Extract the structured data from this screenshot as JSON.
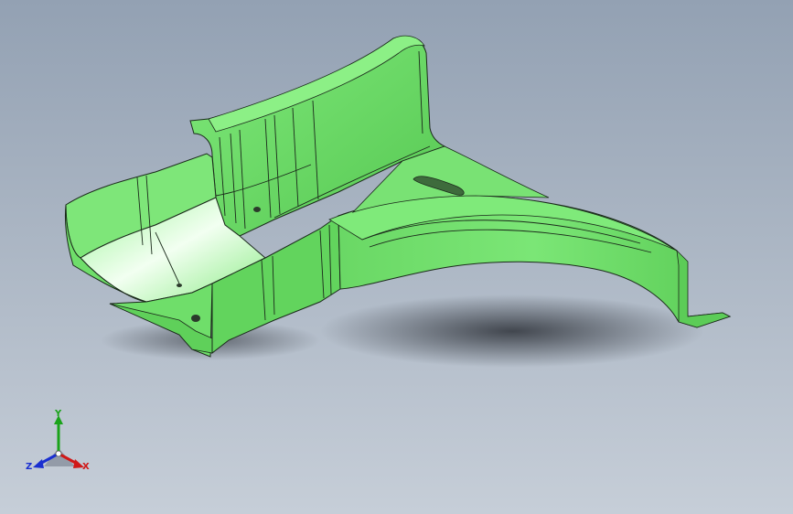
{
  "viewport": {
    "background_top": "#93a1b3",
    "background_bottom": "#c6ced8"
  },
  "model": {
    "part_color": "#6fde6a",
    "edge_color": "#1b2a1b",
    "shadow_color": "#3a3f47"
  },
  "triad": {
    "x_label": "X",
    "y_label": "Y",
    "z_label": "Z",
    "x_color": "#d01818",
    "y_color": "#1aa31a",
    "z_color": "#1a2fd0"
  }
}
